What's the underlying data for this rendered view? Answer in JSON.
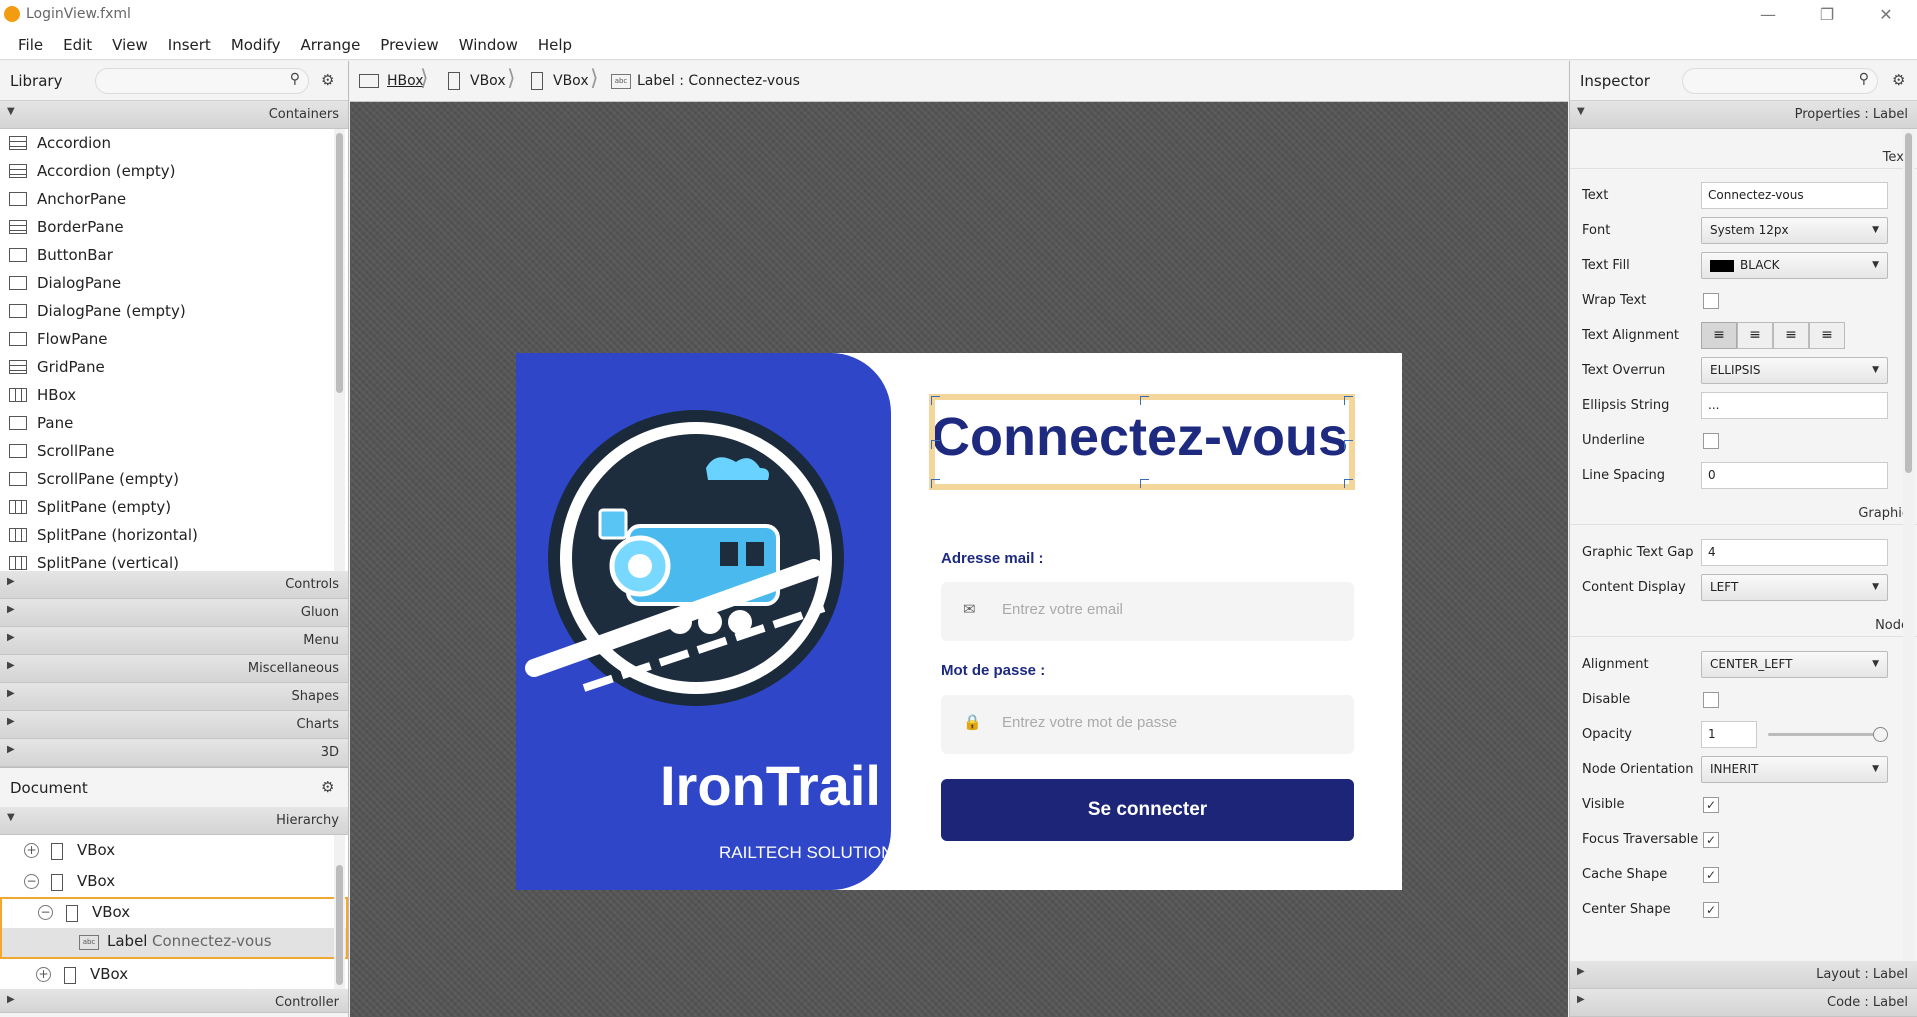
{
  "app": {
    "title": "LoginView.fxml"
  },
  "menu": [
    "File",
    "Edit",
    "View",
    "Insert",
    "Modify",
    "Arrange",
    "Preview",
    "Window",
    "Help"
  ],
  "library": {
    "title": "Library",
    "categories": {
      "containers": "Containers",
      "controls": "Controls",
      "gluon": "Gluon",
      "menu": "Menu",
      "misc": "Miscellaneous",
      "shapes": "Shapes",
      "charts": "Charts",
      "three_d": "3D"
    },
    "items": [
      "Accordion",
      "Accordion  (empty)",
      "AnchorPane",
      "BorderPane",
      "ButtonBar",
      "DialogPane",
      "DialogPane  (empty)",
      "FlowPane",
      "GridPane",
      "HBox",
      "Pane",
      "ScrollPane",
      "ScrollPane  (empty)",
      "SplitPane  (empty)",
      "SplitPane  (horizontal)",
      "SplitPane  (vertical)"
    ]
  },
  "document": {
    "title": "Document",
    "hierarchy_label": "Hierarchy",
    "controller_label": "Controller",
    "tree": {
      "r1": "VBox",
      "r2": "VBox",
      "r3": "VBox",
      "r4_type": "Label",
      "r4_text": "Connectez-vous",
      "r5": "VBox"
    }
  },
  "breadcrumb": {
    "b1": "HBox",
    "b2": "VBox",
    "b3": "VBox",
    "b4": "Label : Connectez-vous"
  },
  "login": {
    "brand": "IronTrail",
    "brand_sub": "RAILTECH SOLUTIONS",
    "heading": "Connectez-vous",
    "email_label": "Adresse mail :",
    "email_placeholder": "Entrez votre email",
    "password_label": "Mot de passe :",
    "password_placeholder": "Entrez votre mot de passe",
    "button": "Se connecter"
  },
  "inspector": {
    "title": "Inspector",
    "properties_header": "Properties : Label",
    "sections": {
      "text": "Text",
      "graphic": "Graphic",
      "node": "Node"
    },
    "labels": {
      "text": "Text",
      "font": "Font",
      "text_fill": "Text Fill",
      "wrap_text": "Wrap Text",
      "text_alignment": "Text Alignment",
      "text_overrun": "Text Overrun",
      "ellipsis_string": "Ellipsis String",
      "underline": "Underline",
      "line_spacing": "Line Spacing",
      "graphic_text_gap": "Graphic Text Gap",
      "content_display": "Content Display",
      "alignment": "Alignment",
      "disable": "Disable",
      "opacity": "Opacity",
      "node_orientation": "Node Orientation",
      "visible": "Visible",
      "focus_traversable": "Focus Traversable",
      "cache_shape": "Cache Shape",
      "center_shape": "Center Shape"
    },
    "values": {
      "text": "Connectez-vous",
      "font": "System 12px",
      "text_fill": "BLACK",
      "text_overrun": "ELLIPSIS",
      "ellipsis_string": "...",
      "line_spacing": "0",
      "graphic_text_gap": "4",
      "content_display": "LEFT",
      "alignment": "CENTER_LEFT",
      "opacity": "1",
      "node_orientation": "INHERIT"
    },
    "opacity_level": 1.0,
    "layout_bar": "Layout : Label",
    "code_bar": "Code : Label"
  },
  "colors": {
    "brand_blue": "#2f46c9",
    "navy": "#1c2577",
    "selection": "#f4d59a"
  }
}
